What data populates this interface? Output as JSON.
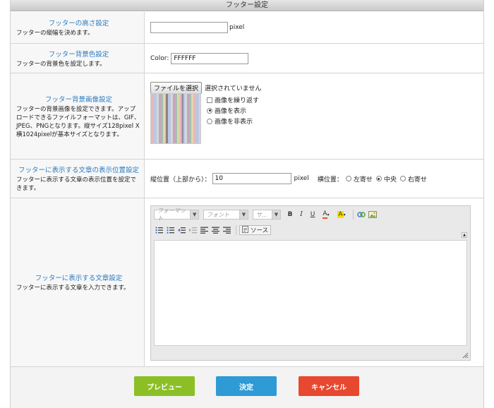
{
  "header": {
    "title": "フッター設定"
  },
  "height": {
    "title": "フッターの高さ設定",
    "desc": "フッターの縦幅を決めます。",
    "value": "",
    "unit": "pixel"
  },
  "bgcolor": {
    "title": "フッター背景色設定",
    "desc": "フッターの背景色を設定します。",
    "color_label": "Color:",
    "value": "FFFFFF"
  },
  "bgimage": {
    "title": "フッター背景画像設定",
    "desc": "フッターの背景画像を設定できます。アップロードできるファイルフォーマットは、GIF、JPEG、PNGとなります。縦サイズ128pixel X 横1024pixelが基本サイズとなります。",
    "file_button": "ファイルを選択",
    "file_status": "選択されていません",
    "repeat_label": "画像を繰り返す",
    "show_label": "画像を表示",
    "hide_label": "画像を非表示",
    "repeat_checked": false,
    "selected": "show"
  },
  "position": {
    "title": "フッターに表示する文章の表示位置設定",
    "desc": "フッターに表示する文章の表示位置を設定できます。",
    "vertical_label": "縦位置（上部から）：",
    "vertical_value": "10",
    "unit": "pixel",
    "horizontal_label": "横位置：",
    "left_label": "左寄せ",
    "center_label": "中央",
    "right_label": "右寄せ",
    "selected": "center"
  },
  "text": {
    "title": "フッターに表示する文章設定",
    "desc": "フッターに表示する文章を入力できます。"
  },
  "editor": {
    "format_placeholder": "フォーマット",
    "font_placeholder": "フォント",
    "size_placeholder": "サ...",
    "bold_icon": "bold-icon",
    "italic_icon": "italic-icon",
    "underline_icon": "underline-icon",
    "text_color_icon": "text-color-icon",
    "bg_color_icon": "background-color-icon",
    "source_label": "ソース",
    "content": ""
  },
  "buttons": {
    "preview": "プレビュー",
    "submit": "決定",
    "cancel": "キャンセル",
    "preview_color": "#8cbf26",
    "submit_color": "#2e9bd6",
    "cancel_color": "#e8482f"
  }
}
